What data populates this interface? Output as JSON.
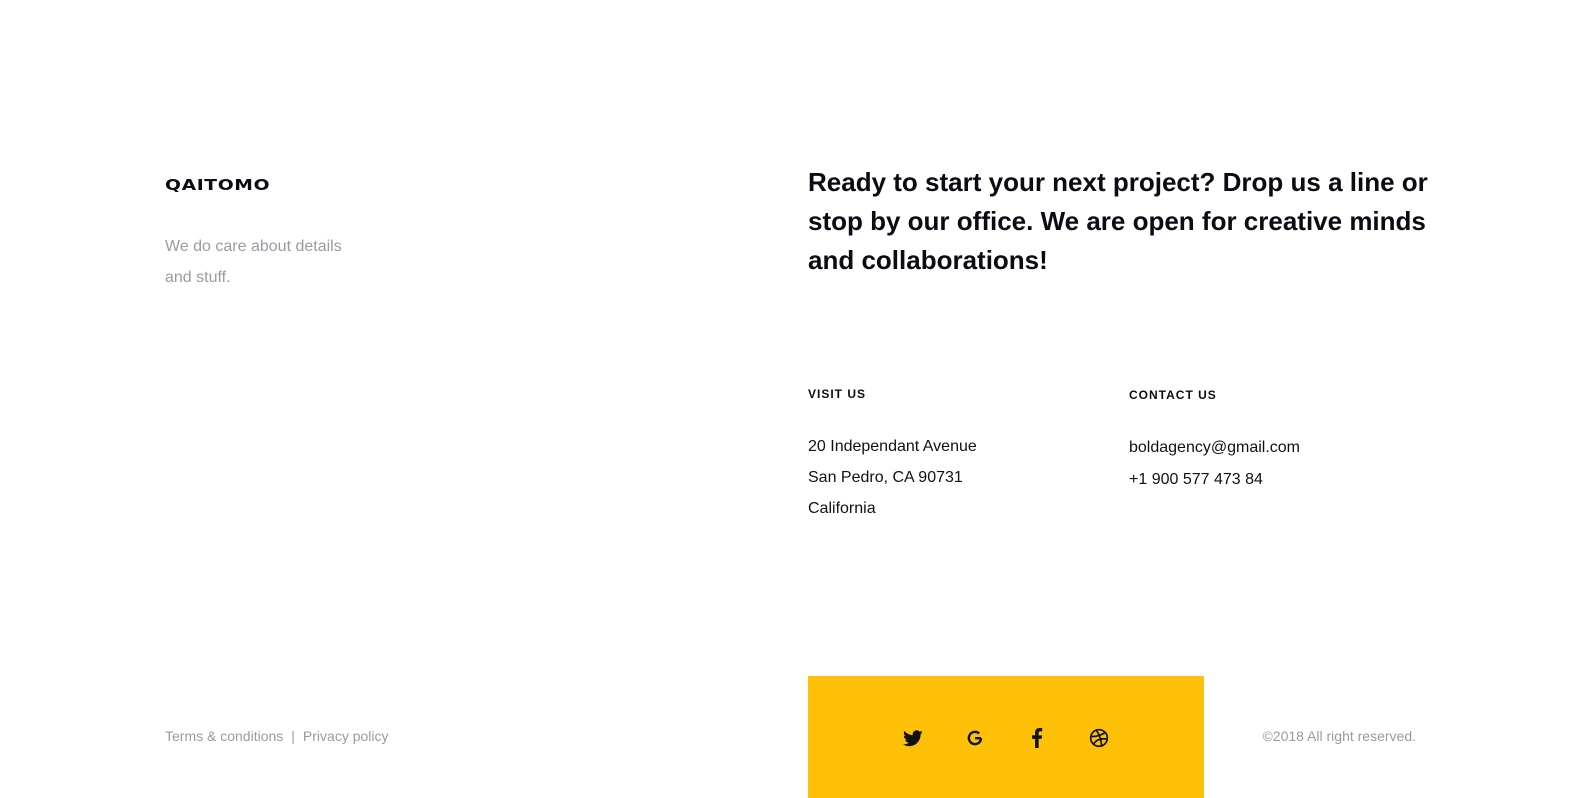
{
  "brand": {
    "logo_text": "QAITOMO",
    "tagline_line1": "We do care about details",
    "tagline_line2": "and stuff."
  },
  "cta": {
    "headline": "Ready to start your next project? Drop us a line or stop by our office. We are open for creative minds and collaborations!"
  },
  "visit": {
    "title": "VISIT US",
    "line1": "20 Independant Avenue",
    "line2": "San Pedro, CA 90731",
    "line3": "California"
  },
  "contact": {
    "title": "CONTACT US",
    "email": "boldagency@gmail.com",
    "phone": "+1 900 577 473 84"
  },
  "footer": {
    "terms_label": "Terms & conditions",
    "separator": "|",
    "privacy_label": "Privacy policy",
    "copyright": "©2018 All right reserved."
  },
  "social": {
    "icons": [
      "twitter-icon",
      "google-icon",
      "facebook-icon",
      "dribbble-icon"
    ]
  },
  "colors": {
    "accent": "#ffc107",
    "text_dark": "#0b0b14",
    "text_muted": "#9a9aa4",
    "background": "#ffffff"
  }
}
